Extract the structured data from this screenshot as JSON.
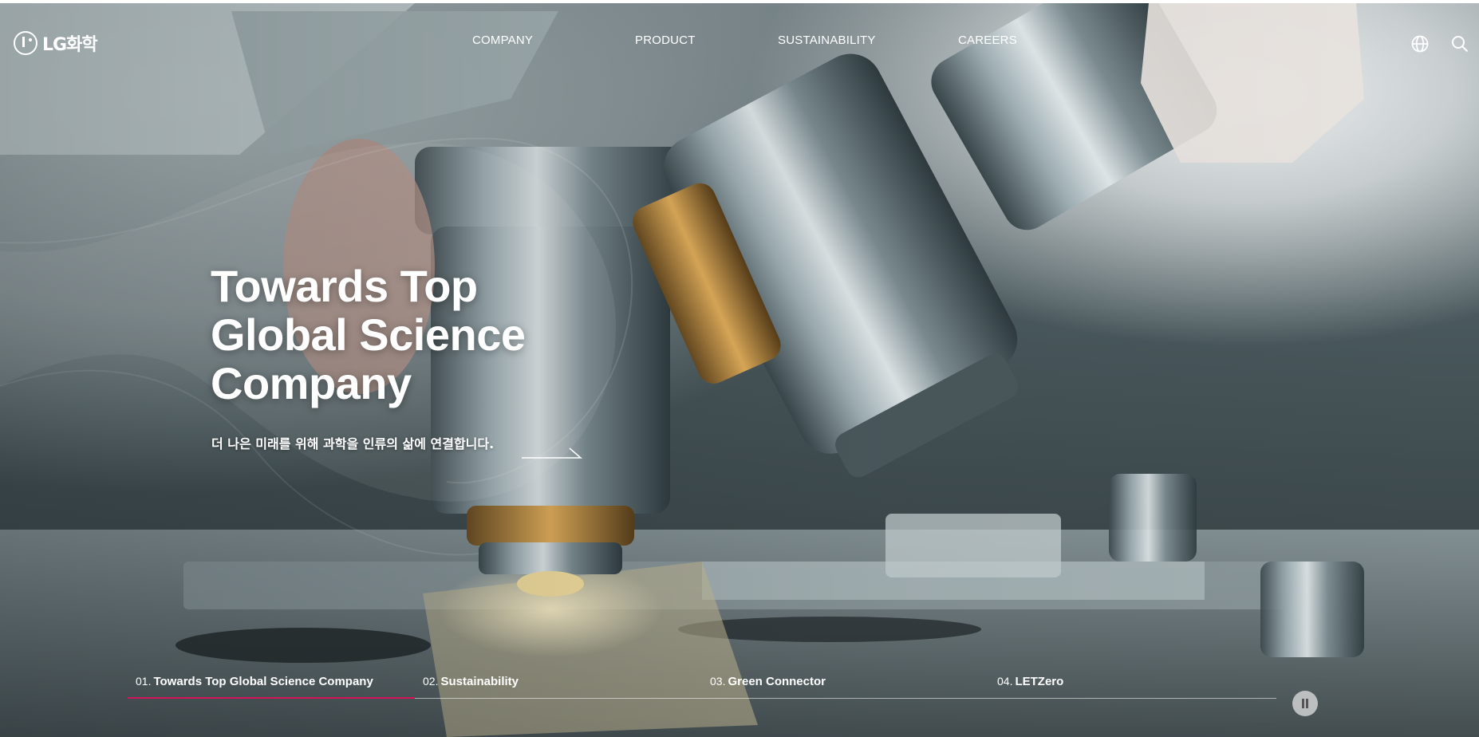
{
  "header": {
    "logo_text": "LG화학",
    "nav": [
      "COMPANY",
      "PRODUCT",
      "SUSTAINABILITY",
      "CAREERS"
    ],
    "icons": [
      "globe-icon",
      "search-icon"
    ]
  },
  "hero": {
    "title_lines": [
      "Towards Top",
      "Global Science",
      "Company"
    ],
    "subtitle": "더 나은 미래를 위해 과학을 인류의 삶에 연결합니다."
  },
  "slides": [
    {
      "num": "01.",
      "label": "Towards Top Global Science Company",
      "active": true
    },
    {
      "num": "02.",
      "label": "Sustainability",
      "active": false
    },
    {
      "num": "03.",
      "label": "Green Connector",
      "active": false
    },
    {
      "num": "04.",
      "label": "LETZero",
      "active": false
    }
  ],
  "progress": {
    "fraction": 0.25
  },
  "colors": {
    "accent": "#d4145a",
    "text": "#ffffff"
  }
}
